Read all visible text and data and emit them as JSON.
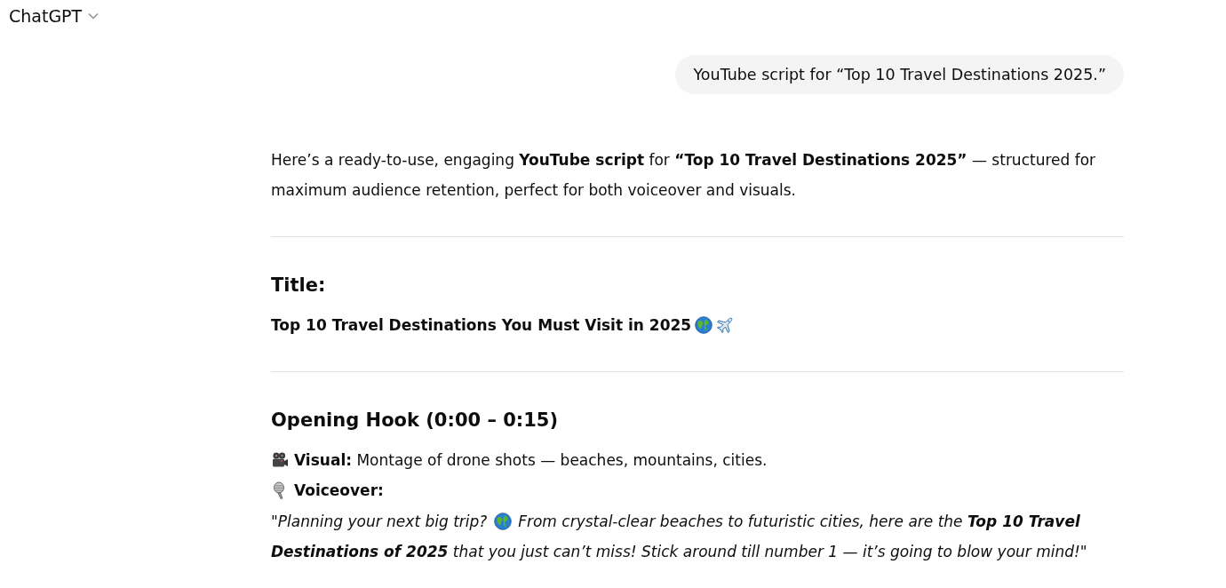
{
  "header": {
    "title": "ChatGPT"
  },
  "user_message": {
    "text": "YouTube script for “Top 10 Travel Destinations 2025.”"
  },
  "response": {
    "intro": "Here’s a ready-to-use, engaging **YouTube script** for **“Top 10 Travel Destinations 2025”** — structured for maximum audience retention, perfect for both voiceover and visuals.",
    "sections": [
      {
        "kind": "title",
        "heading": "Title:",
        "text": "Top 10 Travel Destinations You Must Visit in 2025"
      },
      {
        "kind": "segment",
        "heading": "Opening Hook (0:00 – 0:15)",
        "lines": [
          {
            "kind": "visual",
            "text": "**Visual:** Montage of drone shots — beaches, mountains, cities."
          },
          {
            "kind": "voiceover",
            "text": "Voiceover:"
          }
        ],
        "quote": [
          "\"Planning your next big trip?",
          "From crystal-clear beaches to futuristic cities, here are the **Top 10 Travel Destinations of 2025** that you just can’t miss! Stick around till number 1 — it’s going to blow your mind!\""
        ]
      }
    ]
  }
}
